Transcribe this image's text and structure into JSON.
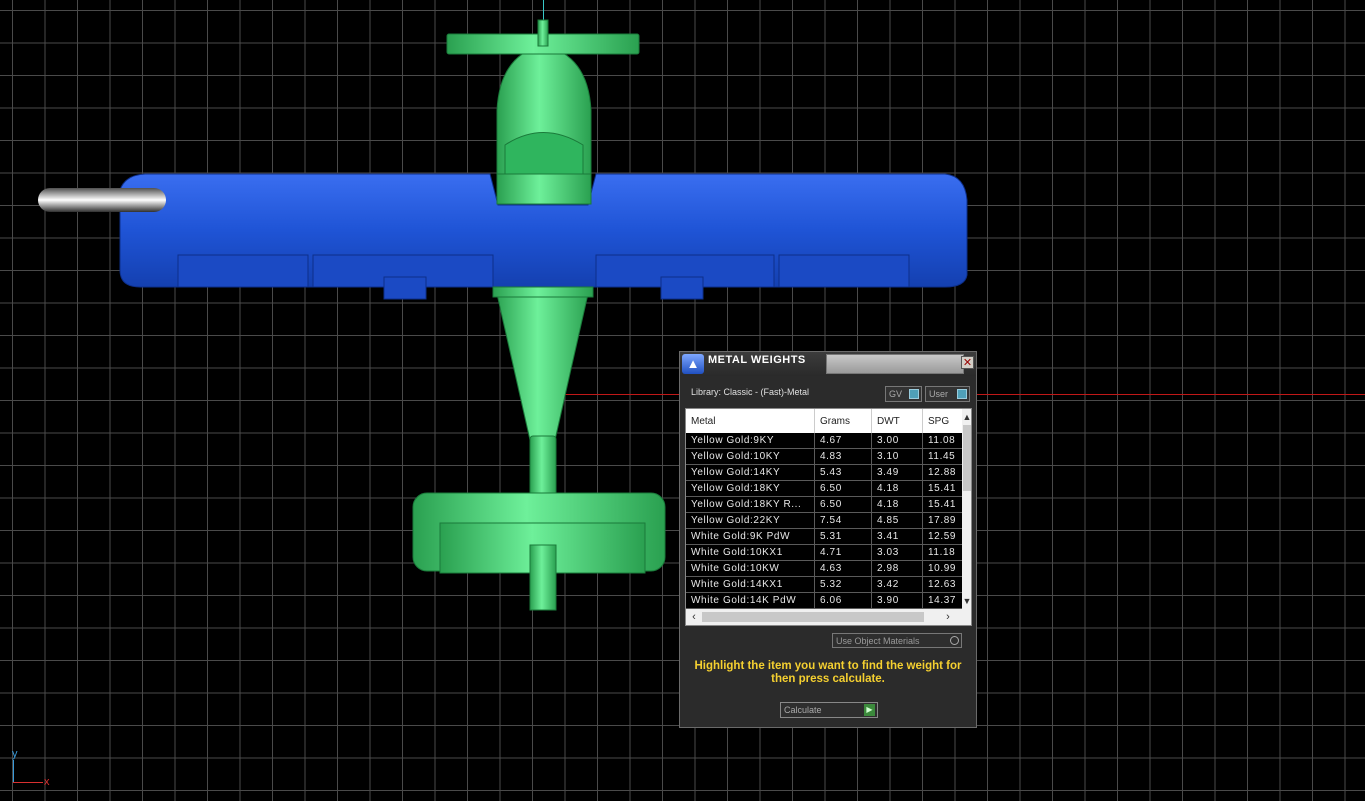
{
  "viewport": {
    "axis_y_label": "y",
    "axis_x_label": "x",
    "grid_color": "#4a4a4a",
    "model": {
      "name": "airplane",
      "fuselage_color": "#3ed078",
      "wing_color": "#1f54d6"
    }
  },
  "panel": {
    "title": "METAL WEIGHTS",
    "close_label": "✕",
    "library_label": "Library: Classic - (Fast)-Metal",
    "gv_label": "GV",
    "user_label": "User",
    "table": {
      "columns": [
        "Metal",
        "Grams",
        "DWT",
        "SPG"
      ],
      "rows": [
        [
          "Yellow Gold:9KY",
          "4.67",
          "3.00",
          "11.08"
        ],
        [
          "Yellow Gold:10KY",
          "4.83",
          "3.10",
          "11.45"
        ],
        [
          "Yellow Gold:14KY",
          "5.43",
          "3.49",
          "12.88"
        ],
        [
          "Yellow Gold:18KY",
          "6.50",
          "4.18",
          "15.41"
        ],
        [
          "Yellow Gold:18KY R...",
          "6.50",
          "4.18",
          "15.41"
        ],
        [
          "Yellow Gold:22KY",
          "7.54",
          "4.85",
          "17.89"
        ],
        [
          "White Gold:9K PdW",
          "5.31",
          "3.41",
          "12.59"
        ],
        [
          "White Gold:10KX1",
          "4.71",
          "3.03",
          "11.18"
        ],
        [
          "White Gold:10KW",
          "4.63",
          "2.98",
          "10.99"
        ],
        [
          "White Gold:14KX1",
          "5.32",
          "3.42",
          "12.63"
        ],
        [
          "White Gold:14K PdW",
          "6.06",
          "3.90",
          "14.37"
        ]
      ]
    },
    "use_materials_label": "Use Object Materials",
    "instruction": "Highlight the item you want to find the weight for then press calculate.",
    "calculate_label": "Calculate",
    "accent_color": "#f5d030"
  }
}
